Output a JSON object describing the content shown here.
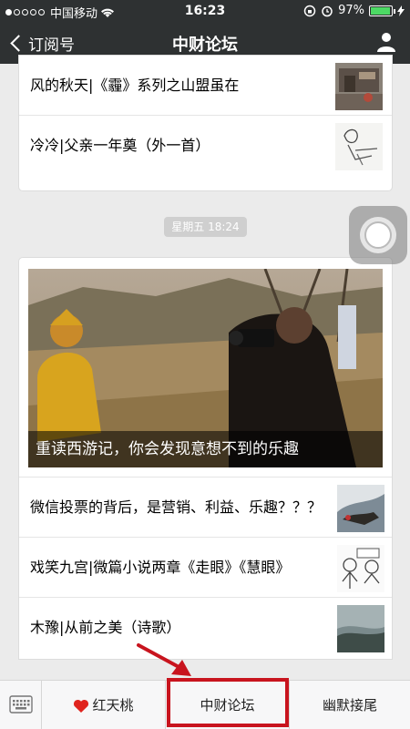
{
  "status_bar": {
    "carrier": "中国移动",
    "time": "16:23",
    "battery": "97%",
    "battery_level": 0.97
  },
  "nav": {
    "back_label": "订阅号",
    "title": "中财论坛"
  },
  "card1": {
    "items": [
      {
        "title": "风的秋天|《霾》系列之山盟虽在"
      },
      {
        "title": "冷冷|父亲一年奠（外一首）"
      }
    ]
  },
  "time_badge": "星期五 18:24",
  "card2": {
    "hero_caption": "重读西游记，你会发现意想不到的乐趣",
    "items": [
      {
        "title": "微信投票的背后，是营销、利益、乐趣？？？"
      },
      {
        "title": "戏笑九宫|微篇小说两章《走眼》《慧眼》"
      },
      {
        "title": "木豫|从前之美（诗歌）"
      }
    ]
  },
  "bottom_menu": {
    "items": [
      {
        "label": "红天桃"
      },
      {
        "label": "中财论坛"
      },
      {
        "label": "幽默接尾"
      }
    ]
  },
  "colors": {
    "bar": "#2e3132",
    "highlight": "#c8141e",
    "battery": "#4cd964"
  }
}
